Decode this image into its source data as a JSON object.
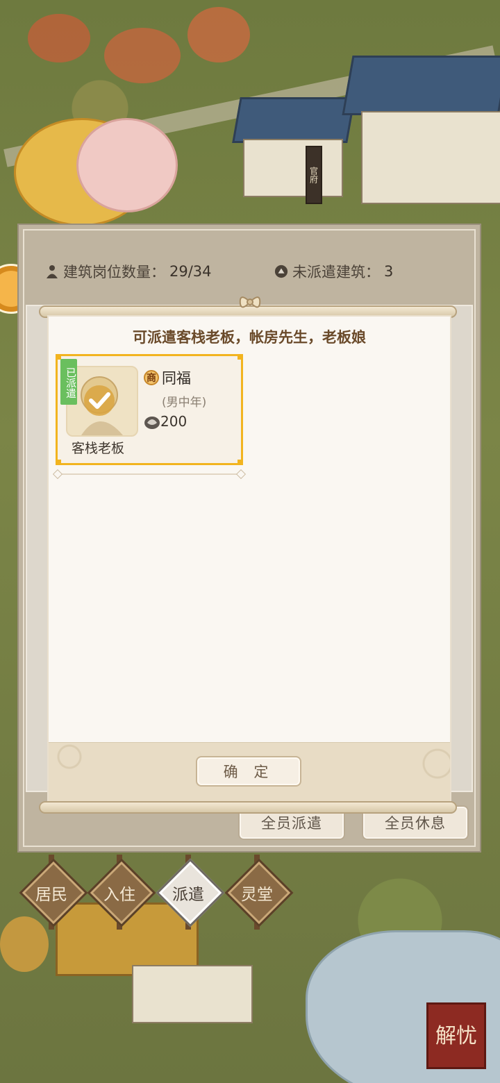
{
  "stats": {
    "positions_label": "建筑岗位数量：",
    "positions_value": "29/34",
    "unassigned_label": "未派遣建筑：",
    "unassigned_value": "3"
  },
  "dialog": {
    "title": "可派遣客栈老板，帐房先生，老板娘",
    "confirm_label": "确 定"
  },
  "worker": {
    "assigned_badge": "已派遣",
    "trade_icon": "商",
    "name": "同福",
    "desc": "(男中年)",
    "cost": "200",
    "role": "客栈老板",
    "selected": true
  },
  "actions": {
    "assign_all": "全员派遣",
    "rest_all": "全员休息"
  },
  "tabs": [
    {
      "label": "居民",
      "active": false
    },
    {
      "label": "入住",
      "active": false
    },
    {
      "label": "派遣",
      "active": true
    },
    {
      "label": "灵堂",
      "active": false
    }
  ],
  "background": {
    "building_sign": "官府",
    "seal_text": "解忧"
  },
  "colors": {
    "selection_border": "#f2b41f",
    "badge_green": "#6abf5e",
    "title_brown": "#6a4a2a"
  }
}
